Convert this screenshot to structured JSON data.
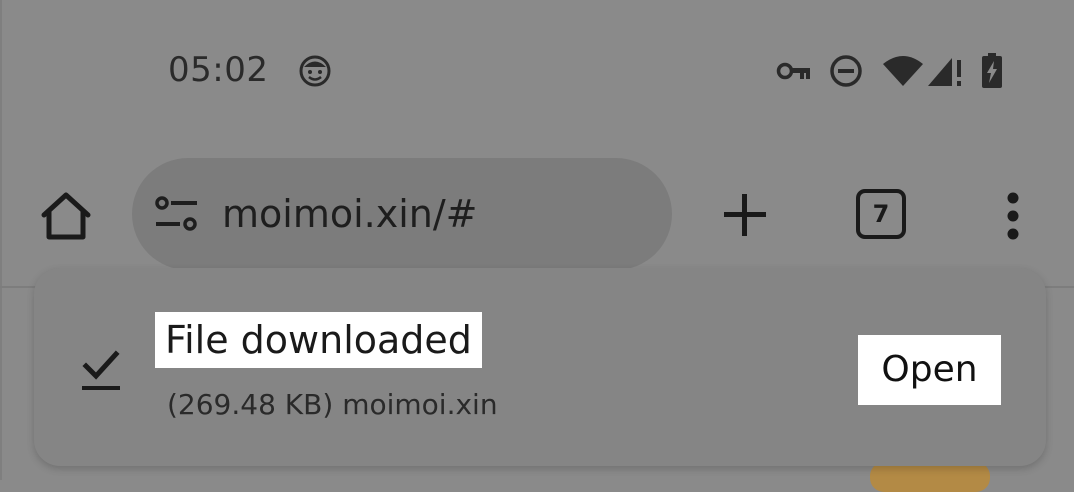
{
  "status_bar": {
    "time": "05:02",
    "left_icons": [
      "face-emoji-icon"
    ],
    "right_icons": [
      "vpn-key-icon",
      "do-not-disturb-icon",
      "wifi-icon",
      "signal-no-data-icon",
      "battery-charging-icon"
    ]
  },
  "toolbar": {
    "url": "moimoi.xin/#",
    "tab_count": "7",
    "icons": [
      "home-icon",
      "tune-icon",
      "plus-icon",
      "tab-switcher-icon",
      "more-vert-icon"
    ]
  },
  "snackbar": {
    "title": "File downloaded",
    "subtitle": "(269.48 KB) moimoi.xin",
    "action_label": "Open",
    "icon": "download-done-icon"
  },
  "colors": {
    "scrim": "#8a8a8a",
    "url_pill": "#7c7c7c",
    "snackbar": "#858585",
    "highlight": "#ffffff"
  }
}
